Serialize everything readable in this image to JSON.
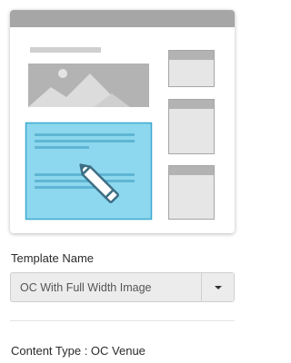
{
  "template_preview": {
    "accent_color": "#8dd8ee",
    "accent_border_color": "#3ea9cf",
    "placeholder_color": "#b3b3b3",
    "header_color": "#a6a6a6",
    "image_icon": "mountain-image-icon",
    "edit_icon": "pencil-icon"
  },
  "template_name": {
    "label": "Template Name",
    "selected_value": "OC With Full Width Image",
    "toggle_icon": "caret-down-icon"
  },
  "content_type": {
    "text": "Content Type : OC Venue"
  }
}
